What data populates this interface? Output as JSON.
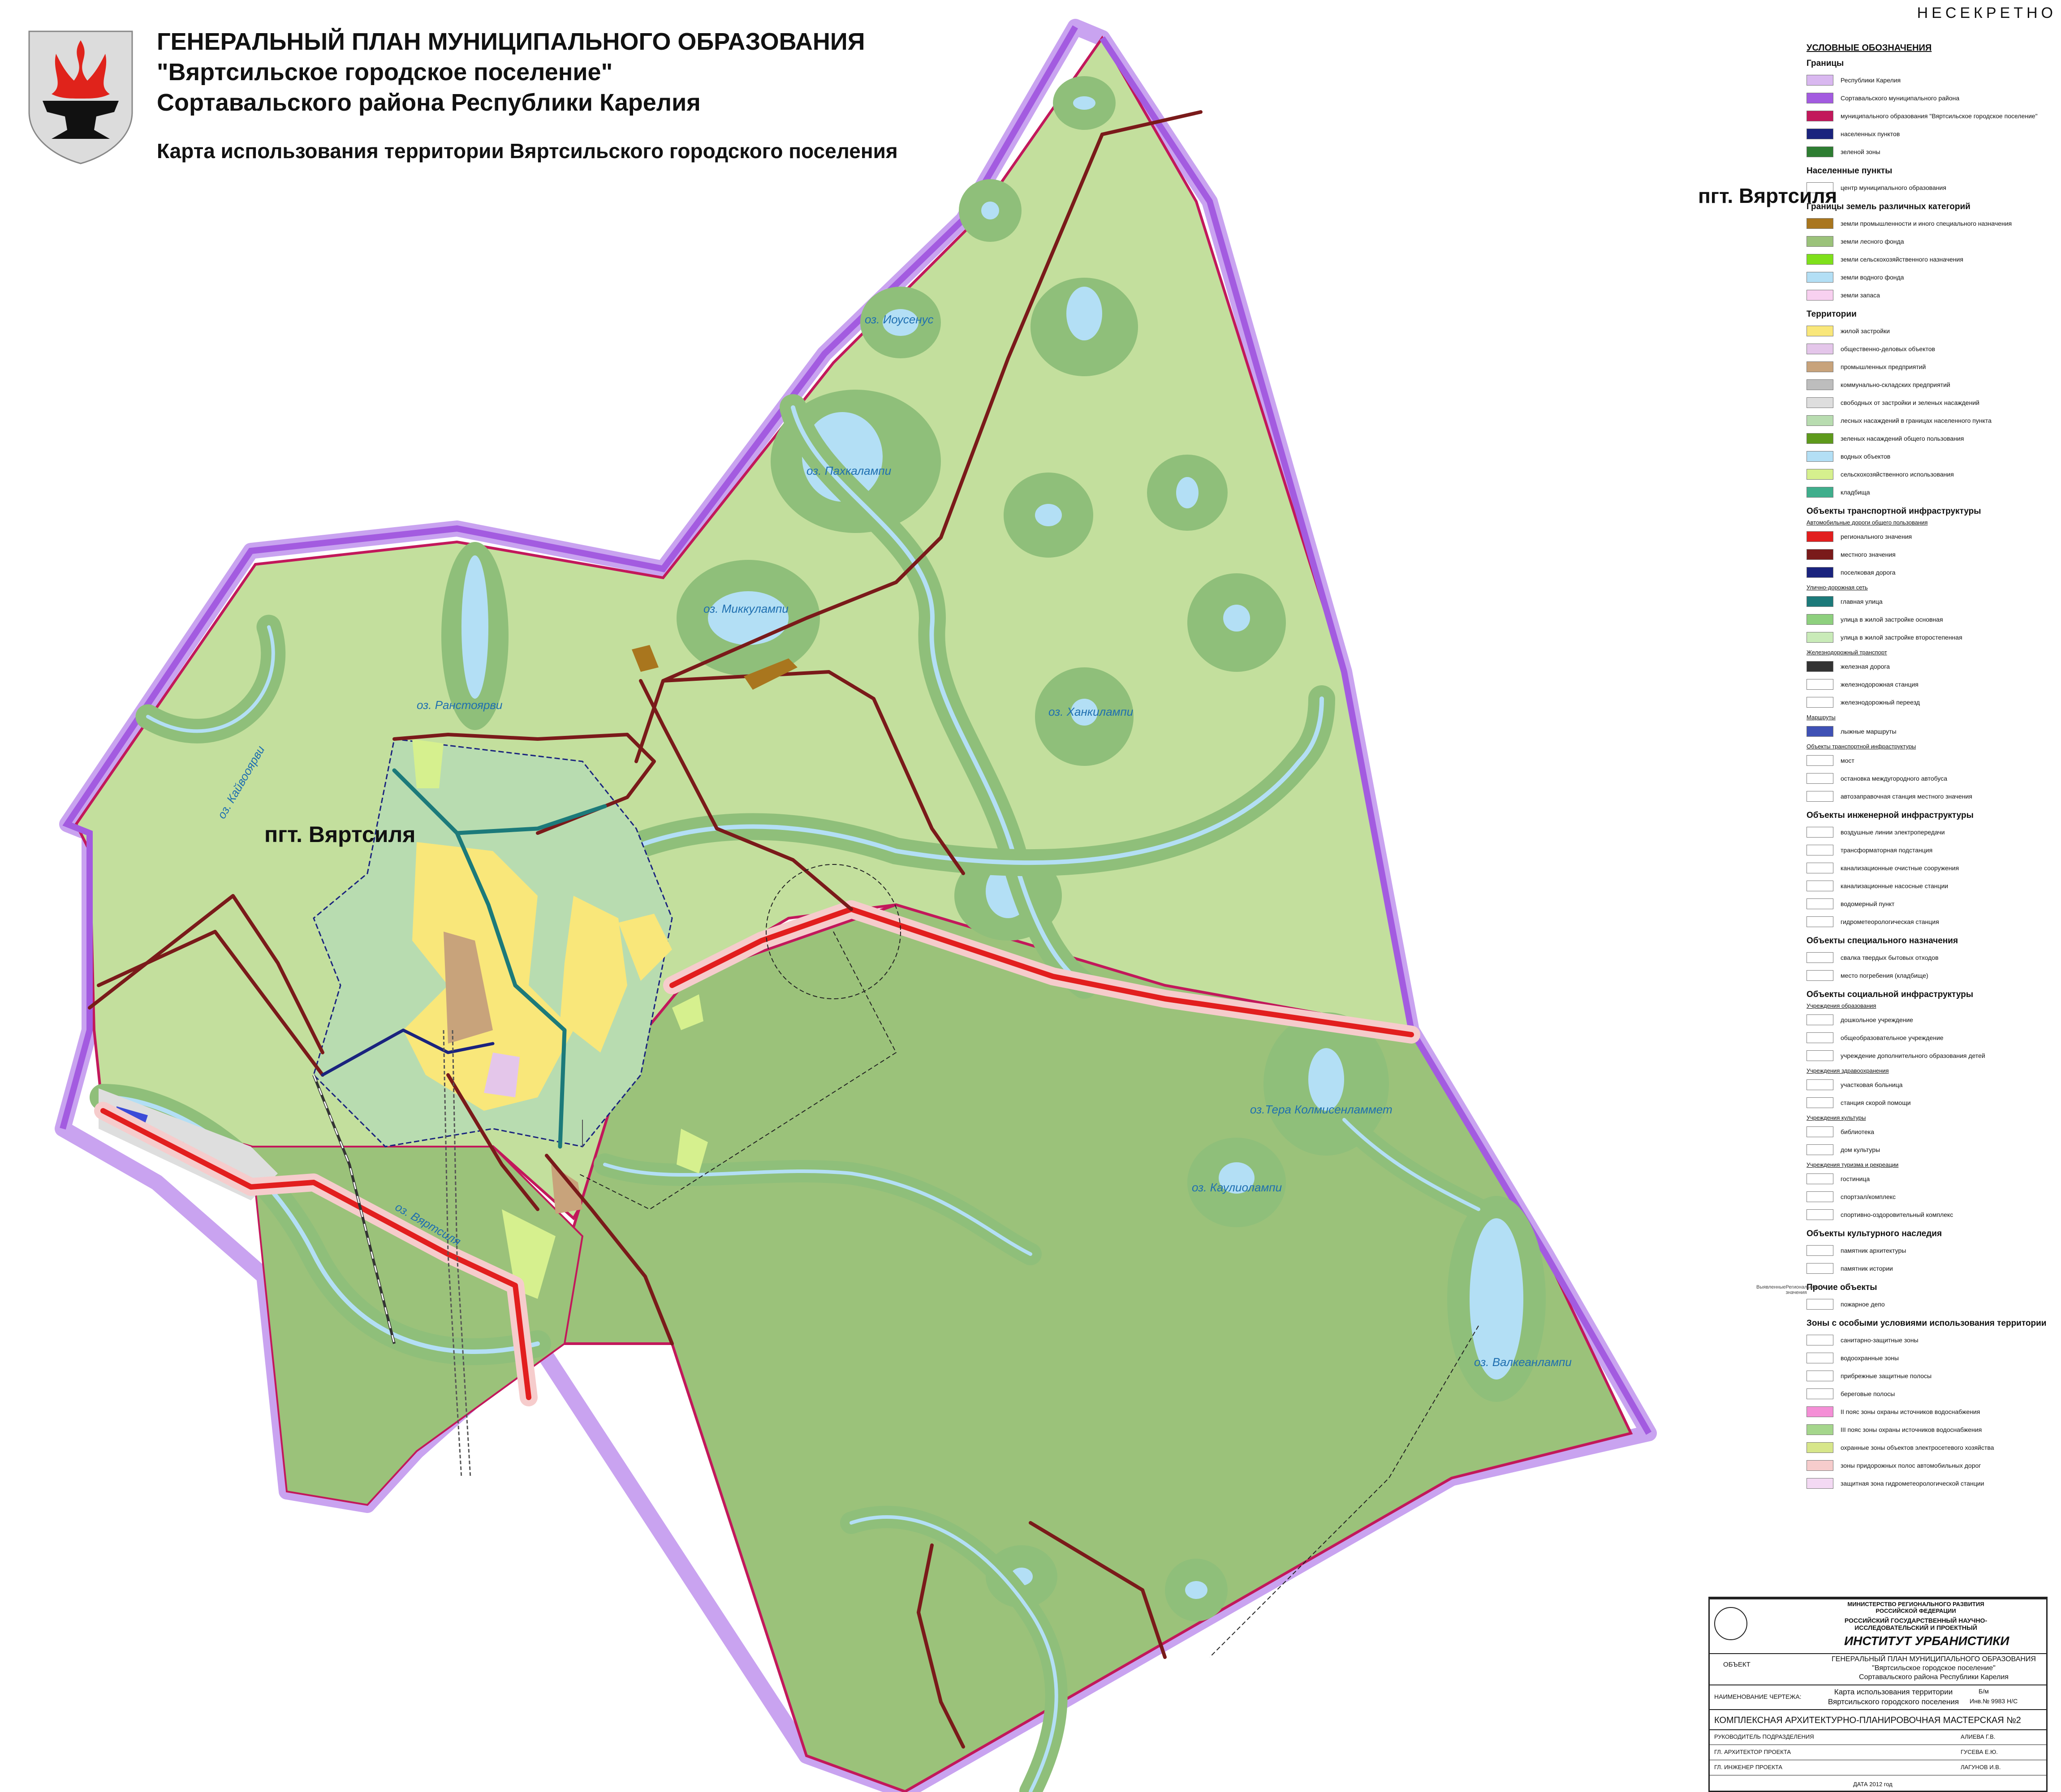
{
  "header": {
    "title_line1": "ГЕНЕРАЛЬНЫЙ ПЛАН МУНИЦИПАЛЬНОГО ОБРАЗОВАНИЯ",
    "title_line2": "\"Вяртсильское городское поселение\"",
    "title_line3": "Сортавальского района Республики Карелия",
    "subtitle": "Карта использования территории Вяртсильского городского поселения",
    "classification": "НЕСЕКРЕТНО"
  },
  "map": {
    "settlement_label": "пгт. Вяртсиля",
    "lakes": [
      "оз. Иоусенус",
      "оз. Пахкалампи",
      "оз. Миккулампи",
      "оз. Ранстоярви",
      "оз. Ханкилампи",
      "оз. Кайвооярви",
      "оз. Вяртсиля",
      "оз.Тера Колмисенламмет",
      "оз. Каулиолампи",
      "оз. Валкеанлампи"
    ],
    "colors": {
      "forest_fund": "#c3df9d",
      "forest_dark": "#9bc27a",
      "buffer": "#8fbf7a",
      "water": "#b3dff5",
      "regional_road": "#e21e1e",
      "local_road": "#7a1a1a",
      "district_border": "#b67fe6",
      "settlement_border": "#c2185b"
    }
  },
  "legend": {
    "heading": "УСЛОВНЫЕ ОБОЗНАЧЕНИЯ",
    "sections": [
      {
        "title": "Границы",
        "items": [
          {
            "label": "Республики Карелия",
            "color": "#d9b8f0"
          },
          {
            "label": "Сортавальского муниципального района",
            "color": "#a35be0"
          },
          {
            "label": "муниципального образования \"Вяртсильское городское поселение\"",
            "color": "#c2185b"
          },
          {
            "label": "населенных пунктов",
            "color": "#1a237e"
          },
          {
            "label": "зеленой зоны",
            "color": "#2e7d32"
          }
        ]
      },
      {
        "title": "Населенные пункты",
        "items": [
          {
            "label": "центр муниципального образования",
            "color": "#ffffff"
          }
        ]
      },
      {
        "title": "Границы земель различных категорий",
        "items": [
          {
            "label": "земли промышленности и иного специального назначения",
            "color": "#a9761e"
          },
          {
            "label": "земли лесного фонда",
            "color": "#9bc27a"
          },
          {
            "label": "земли сельскохозяйственного назначения",
            "color": "#7fe01b"
          },
          {
            "label": "земли водного фонда",
            "color": "#b3dff5"
          },
          {
            "label": "земли запаса",
            "color": "#f8d0f0"
          }
        ]
      },
      {
        "title": "Территории",
        "items": [
          {
            "label": "жилой застройки",
            "color": "#f9e77a"
          },
          {
            "label": "общественно-деловых объектов",
            "color": "#e4c6ea"
          },
          {
            "label": "промышленных предприятий",
            "color": "#c8a37b"
          },
          {
            "label": "коммунально-складских предприятий",
            "color": "#bdbdbd"
          },
          {
            "label": "свободных от застройки и зеленых насаждений",
            "color": "#dedede"
          },
          {
            "label": "лесных насаждений в границах населенного пункта",
            "color": "#b8dcb0"
          },
          {
            "label": "зеленых насаждений общего пользования",
            "color": "#5e9a1c"
          },
          {
            "label": "водных объектов",
            "color": "#b3dff5"
          },
          {
            "label": "сельскохозяйственного использования",
            "color": "#d6f08e"
          },
          {
            "label": "кладбища",
            "color": "#3fae8c"
          }
        ]
      },
      {
        "title": "Объекты транспортной инфраструктуры",
        "sub": "Автомобильные дороги общего пользования",
        "items": [
          {
            "label": "регионального значения",
            "color": "#e21e1e"
          },
          {
            "label": "местного значения",
            "color": "#7a1a1a"
          },
          {
            "label": "поселковая дорога",
            "color": "#1a237e"
          }
        ]
      },
      {
        "title": "",
        "sub": "Улично-дорожная сеть",
        "items": [
          {
            "label": "главная улица",
            "color": "#1c7a7a"
          },
          {
            "label": "улица в жилой застройке основная",
            "color": "#8ed07e"
          },
          {
            "label": "улица в жилой застройке второстепенная",
            "color": "#c9ebb8"
          }
        ]
      },
      {
        "title": "",
        "sub": "Железнодорожный транспорт",
        "items": [
          {
            "label": "железная дорога",
            "color": "#333333"
          },
          {
            "label": "железнодорожная станция",
            "color": "#ffffff"
          },
          {
            "label": "железнодорожный переезд",
            "color": "#ffffff"
          }
        ]
      },
      {
        "title": "",
        "sub": "Маршруты",
        "items": [
          {
            "label": "лыжные маршруты",
            "color": "#3f51b5"
          }
        ]
      },
      {
        "title": "",
        "sub": "Объекты транспортной инфраструктуры",
        "items": [
          {
            "label": "мост",
            "color": "#ffffff"
          },
          {
            "label": "остановка междугородного автобуса",
            "color": "#ffffff"
          },
          {
            "label": "автозаправочная станция местного значения",
            "color": "#ffffff"
          }
        ]
      },
      {
        "title": "Объекты инженерной инфраструктуры",
        "items": [
          {
            "label": "воздушные линии электропередачи",
            "color": "#ffffff"
          },
          {
            "label": "трансформаторная подстанция",
            "color": "#ffffff"
          },
          {
            "label": "канализационные очистные сооружения",
            "color": "#ffffff"
          },
          {
            "label": "канализационные насосные станции",
            "color": "#ffffff"
          },
          {
            "label": "водомерный пункт",
            "color": "#ffffff"
          },
          {
            "label": "гидрометеорологическая станция",
            "color": "#ffffff"
          }
        ]
      },
      {
        "title": "Объекты специального назначения",
        "items": [
          {
            "label": "свалка твердых бытовых отходов",
            "color": "#ffffff"
          },
          {
            "label": "место погребения (кладбище)",
            "color": "#ffffff"
          }
        ]
      },
      {
        "title": "Объекты социальной инфраструктуры",
        "sub": "Учреждения образования",
        "items": [
          {
            "label": "дошкольное учреждение",
            "color": "#ffffff"
          },
          {
            "label": "общеобразовательное учреждение",
            "color": "#ffffff"
          },
          {
            "label": "учреждение дополнительного образования детей",
            "color": "#ffffff"
          }
        ]
      },
      {
        "title": "",
        "sub": "Учреждения здравоохранения",
        "items": [
          {
            "label": "участковая больница",
            "color": "#ffffff"
          },
          {
            "label": "станция скорой помощи",
            "color": "#ffffff"
          }
        ]
      },
      {
        "title": "",
        "sub": "Учреждения культуры",
        "items": [
          {
            "label": "библиотека",
            "color": "#ffffff"
          },
          {
            "label": "дом культуры",
            "color": "#ffffff"
          }
        ]
      },
      {
        "title": "",
        "sub": "Учреждения туризма и рекреации",
        "items": [
          {
            "label": "гостиница",
            "color": "#ffffff"
          },
          {
            "label": "спортзал/комплекс",
            "color": "#ffffff"
          },
          {
            "label": "спортивно-оздоровительный комплекс",
            "color": "#ffffff"
          }
        ]
      },
      {
        "title": "Объекты культурного наследия",
        "items": [
          {
            "label": "памятник архитектуры",
            "color": "#ffffff"
          },
          {
            "label": "памятник истории",
            "color": "#ffffff"
          }
        ]
      },
      {
        "title": "Прочие объекты",
        "items": [
          {
            "label": "пожарное депо",
            "color": "#ffffff"
          }
        ]
      },
      {
        "title": "Зоны с особыми условиями использования территории",
        "items": [
          {
            "label": "санитарно-защитные зоны",
            "color": "#ffffff"
          },
          {
            "label": "водоохранные зоны",
            "color": "#ffffff"
          },
          {
            "label": "прибрежные защитные полосы",
            "color": "#ffffff"
          },
          {
            "label": "береговые полосы",
            "color": "#ffffff"
          },
          {
            "label": "II пояс зоны охраны источников водоснабжения",
            "color": "#f48fd6"
          },
          {
            "label": "III пояс зоны охраны источников водоснабжения",
            "color": "#a5d68c"
          },
          {
            "label": "охранные зоны объектов электросетевого хозяйства",
            "color": "#d7e68a"
          },
          {
            "label": "зоны придорожных полос автомобильных дорог",
            "color": "#f6cccc"
          },
          {
            "label": "защитная зона гидрометеорологической станции",
            "color": "#f3d9f3"
          }
        ]
      }
    ],
    "center_name": "пгт. Вяртсиля",
    "heritage_cols": [
      "Выявленные",
      "Регионального значения"
    ]
  },
  "stamp": {
    "ministry": "МИНИСТЕРСТВО РЕГИОНАЛЬНОГО РАЗВИТИЯ РОССИЙСКОЙ ФЕДЕРАЦИИ",
    "institute_full": "РОССИЙСКИЙ ГОСУДАРСТВЕННЫЙ НАУЧНО-ИССЛЕДОВАТЕЛЬСКИЙ И ПРОЕКТНЫЙ",
    "institute": "ИНСТИТУТ   УРБАНИСТИКИ",
    "object_label": "ОБЪЕКТ",
    "object_line1": "ГЕНЕРАЛЬНЫЙ ПЛАН МУНИЦИПАЛЬНОГО ОБРАЗОВАНИЯ",
    "object_line2": "\"Вяртсильское городское поселение\"",
    "object_line3": "Сортавальского района Республики Карелия",
    "drawing_label": "НАИМЕНОВАНИЕ ЧЕРТЕЖА:",
    "drawing_line1": "Карта использования территории",
    "drawing_line2": "Вяртсильского городского поселения",
    "inv_label": "Б/м",
    "inv_no": "Инв.№ 9983 Н/С",
    "workshop": "КОМПЛЕКСНАЯ АРХИТЕКТУРНО-ПЛАНИРОВОЧНАЯ МАСТЕРСКАЯ №2",
    "roles": [
      "РУКОВОДИТЕЛЬ ПОДРАЗДЕЛЕНИЯ",
      "ГЛ. АРХИТЕКТОР ПРОЕКТА",
      "ГЛ. ИНЖЕНЕР ПРОЕКТА"
    ],
    "names": [
      "АЛИЕВА Г.В.",
      "ГУСЕВА Е.Ю.",
      "ЛАГУНОВ И.В."
    ],
    "date": "ДАТА 2012 год"
  }
}
